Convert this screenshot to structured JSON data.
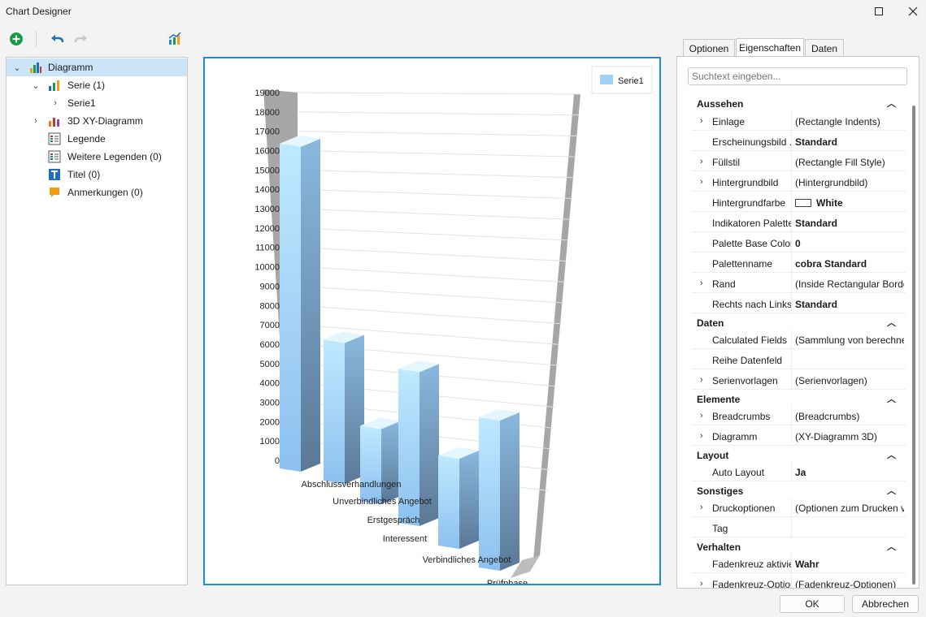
{
  "window": {
    "title": "Chart Designer"
  },
  "tree": [
    {
      "label": "Diagramm"
    },
    {
      "label": "Serie (1)"
    },
    {
      "label": "Serie1"
    },
    {
      "label": "3D XY-Diagramm"
    },
    {
      "label": "Legende"
    },
    {
      "label": "Weitere Legenden (0)"
    },
    {
      "label": "Titel (0)"
    },
    {
      "label": "Anmerkungen (0)"
    }
  ],
  "tabs": [
    "Optionen",
    "Eigenschaften",
    "Daten"
  ],
  "search": {
    "placeholder": "Suchtext eingeben..."
  },
  "properties": {
    "cat_aussehen": "Aussehen",
    "einlage": {
      "name": "Einlage",
      "value": "(Rectangle Indents)"
    },
    "erscheinungsbild": {
      "name": "Erscheinungsbild ...",
      "value": "Standard"
    },
    "fuellstil": {
      "name": "Füllstil",
      "value": "(Rectangle Fill Style)"
    },
    "hintergrundbild": {
      "name": "Hintergrundbild",
      "value": "(Hintergrundbild)"
    },
    "hintergrundfarbe": {
      "name": "Hintergrundfarbe",
      "value": "White"
    },
    "indikatoren": {
      "name": "Indikatoren Palette",
      "value": "Standard"
    },
    "palette_base": {
      "name": "Palette Base Color",
      "value": "0"
    },
    "palettenname": {
      "name": "Palettenname",
      "value": "cobra Standard"
    },
    "rand": {
      "name": "Rand",
      "value": "(Inside Rectangular Border)"
    },
    "rechts_nach_links": {
      "name": "Rechts nach Links",
      "value": "Standard"
    },
    "cat_daten": "Daten",
    "calculated_fields": {
      "name": "Calculated Fields",
      "value": "(Sammlung von berechneten Feldern)"
    },
    "reihe_datenfeld": {
      "name": "Reihe Datenfeld",
      "value": ""
    },
    "serienvorlagen": {
      "name": "Serienvorlagen",
      "value": "(Serienvorlagen)"
    },
    "cat_elemente": "Elemente",
    "breadcrumbs": {
      "name": "Breadcrumbs",
      "value": "(Breadcrumbs)"
    },
    "diagramm": {
      "name": "Diagramm",
      "value": "(XY-Diagramm 3D)"
    },
    "cat_layout": "Layout",
    "auto_layout": {
      "name": "Auto Layout",
      "value": "Ja"
    },
    "cat_sonstiges": "Sonstiges",
    "druckoptionen": {
      "name": "Druckoptionen",
      "value": "(Optionen zum Drucken von Diagrammen)"
    },
    "tag": {
      "name": "Tag",
      "value": ""
    },
    "cat_verhalten": "Verhalten",
    "fadenkreuz_aktiviert": {
      "name": "Fadenkreuz aktiviert",
      "value": "Wahr"
    },
    "fadenkreuz_optionen": {
      "name": "Fadenkreuz-Optionen",
      "value": "(Fadenkreuz-Optionen)"
    }
  },
  "buttons": {
    "ok": "OK",
    "cancel": "Abbrechen"
  },
  "colors": {
    "accent": "#1e8cd2",
    "selection": "#cce4f7",
    "bar_light": "#a6d8fb",
    "bar_dark": "#6e8fae"
  },
  "chart_data": {
    "type": "bar",
    "categories": [
      "Abschlussverhandlungen",
      "Unverbindliches Angebot",
      "Erstgespräch",
      "Interessent",
      "Verbindliches Angebot",
      "Prüfphase"
    ],
    "series": [
      {
        "name": "Serie1",
        "values": [
          17300,
          7500,
          4000,
          8200,
          4800,
          8000
        ]
      }
    ],
    "ylim": [
      0,
      19000
    ],
    "yticks": [
      0,
      1000,
      2000,
      3000,
      4000,
      5000,
      6000,
      7000,
      8000,
      9000,
      10000,
      11000,
      12000,
      13000,
      14000,
      15000,
      16000,
      17000,
      18000,
      19000
    ],
    "legend": "top-right",
    "grid": true
  }
}
